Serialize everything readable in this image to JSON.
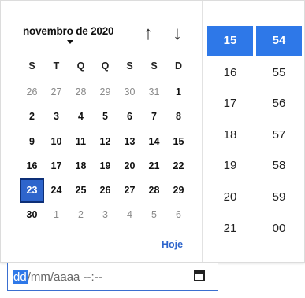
{
  "calendar": {
    "month_label": "novembro de 2020",
    "prev_icon": "↑",
    "next_icon": "↓",
    "weekdays": [
      "S",
      "T",
      "Q",
      "Q",
      "S",
      "S",
      "D"
    ],
    "weeks": [
      [
        {
          "d": "26",
          "o": true
        },
        {
          "d": "27",
          "o": true
        },
        {
          "d": "28",
          "o": true
        },
        {
          "d": "29",
          "o": true
        },
        {
          "d": "30",
          "o": true
        },
        {
          "d": "31",
          "o": true
        },
        {
          "d": "1"
        }
      ],
      [
        {
          "d": "2"
        },
        {
          "d": "3"
        },
        {
          "d": "4"
        },
        {
          "d": "5"
        },
        {
          "d": "6"
        },
        {
          "d": "7"
        },
        {
          "d": "8"
        }
      ],
      [
        {
          "d": "9"
        },
        {
          "d": "10"
        },
        {
          "d": "11"
        },
        {
          "d": "12"
        },
        {
          "d": "13"
        },
        {
          "d": "14"
        },
        {
          "d": "15"
        }
      ],
      [
        {
          "d": "16"
        },
        {
          "d": "17"
        },
        {
          "d": "18"
        },
        {
          "d": "19"
        },
        {
          "d": "20"
        },
        {
          "d": "21"
        },
        {
          "d": "22"
        }
      ],
      [
        {
          "d": "23",
          "sel": true
        },
        {
          "d": "24"
        },
        {
          "d": "25"
        },
        {
          "d": "26"
        },
        {
          "d": "27"
        },
        {
          "d": "28"
        },
        {
          "d": "29"
        }
      ],
      [
        {
          "d": "30"
        },
        {
          "d": "1",
          "o": true
        },
        {
          "d": "2",
          "o": true
        },
        {
          "d": "3",
          "o": true
        },
        {
          "d": "4",
          "o": true
        },
        {
          "d": "5",
          "o": true
        },
        {
          "d": "6",
          "o": true
        }
      ]
    ],
    "today_label": "Hoje"
  },
  "time": {
    "hours": [
      "15",
      "16",
      "17",
      "18",
      "19",
      "20",
      "21"
    ],
    "minutes": [
      "54",
      "55",
      "56",
      "57",
      "58",
      "59",
      "00"
    ],
    "selected_hour": "15",
    "selected_minute": "54"
  },
  "input": {
    "day_segment": "dd",
    "rest": "/mm/aaaa --:--",
    "icon": "calendar-icon"
  },
  "colors": {
    "accent": "#2e78e8",
    "selected_day": "#2e65cc",
    "muted_day": "#8a8a8a"
  }
}
